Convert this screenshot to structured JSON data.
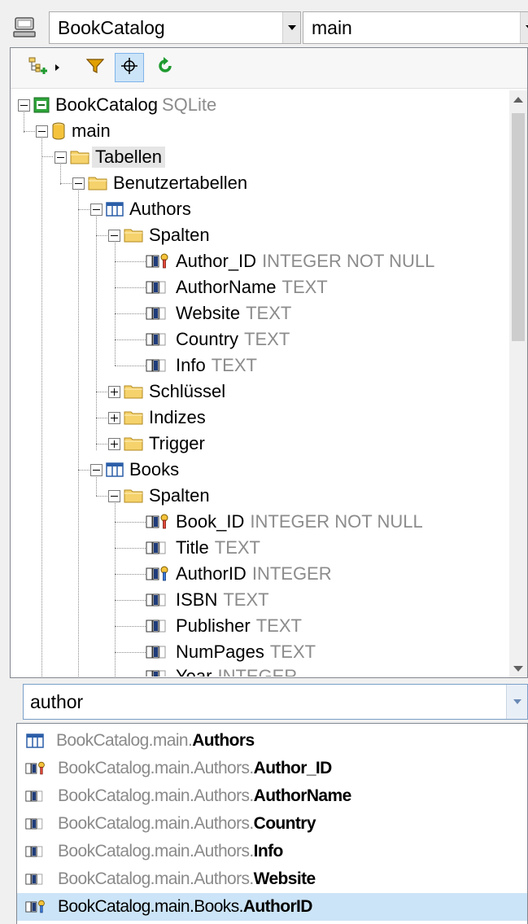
{
  "connection": {
    "database": "BookCatalog",
    "schema": "main"
  },
  "toolbar": {
    "buttons": [
      {
        "name": "add-objects",
        "icon": "add-node-icon"
      },
      {
        "name": "filter",
        "icon": "funnel-icon"
      },
      {
        "name": "locate",
        "icon": "crosshair-icon"
      },
      {
        "name": "refresh",
        "icon": "refresh-icon"
      }
    ]
  },
  "tree": {
    "root": {
      "label": "BookCatalog",
      "type": "SQLite"
    },
    "schema": {
      "label": "main"
    },
    "tables_folder": {
      "label": "Tabellen"
    },
    "user_tables_folder": {
      "label": "Benutzertabellen"
    },
    "authors": {
      "label": "Authors",
      "columns_folder": "Spalten",
      "columns": [
        {
          "name": "Author_ID",
          "type": "INTEGER NOT NULL",
          "key": true
        },
        {
          "name": "AuthorName",
          "type": "TEXT",
          "key": false
        },
        {
          "name": "Website",
          "type": "TEXT",
          "key": false
        },
        {
          "name": "Country",
          "type": "TEXT",
          "key": false
        },
        {
          "name": "Info",
          "type": "TEXT",
          "key": false
        }
      ],
      "keys_folder": "Schlüssel",
      "indexes_folder": "Indizes",
      "triggers_folder": "Trigger"
    },
    "books": {
      "label": "Books",
      "columns_folder": "Spalten",
      "columns": [
        {
          "name": "Book_ID",
          "type": "INTEGER NOT NULL",
          "key": true
        },
        {
          "name": "Title",
          "type": "TEXT",
          "key": false
        },
        {
          "name": "AuthorID",
          "type": "INTEGER",
          "key": true
        },
        {
          "name": "ISBN",
          "type": "TEXT",
          "key": false
        },
        {
          "name": "Publisher",
          "type": "TEXT",
          "key": false
        },
        {
          "name": "NumPages",
          "type": "TEXT",
          "key": false
        },
        {
          "name": "Year",
          "type": "INTEGER",
          "key": false
        }
      ]
    }
  },
  "search": {
    "value": "author"
  },
  "results": [
    {
      "prefix": "BookCatalog.main.",
      "name": "Authors",
      "kind": "table"
    },
    {
      "prefix": "BookCatalog.main.Authors.",
      "name": "Author_ID",
      "kind": "key-column"
    },
    {
      "prefix": "BookCatalog.main.Authors.",
      "name": "AuthorName",
      "kind": "column"
    },
    {
      "prefix": "BookCatalog.main.Authors.",
      "name": "Country",
      "kind": "column"
    },
    {
      "prefix": "BookCatalog.main.Authors.",
      "name": "Info",
      "kind": "column"
    },
    {
      "prefix": "BookCatalog.main.Authors.",
      "name": "Website",
      "kind": "column"
    },
    {
      "prefix": "BookCatalog.main.Books.",
      "name": "AuthorID",
      "kind": "key-column",
      "selected": true
    }
  ],
  "colors": {
    "folder": "#f5d26b",
    "type_text": "#8c8c8c",
    "selection": "#cce4f7",
    "refresh": "#1f9a2f",
    "filter": "#e0a000"
  }
}
